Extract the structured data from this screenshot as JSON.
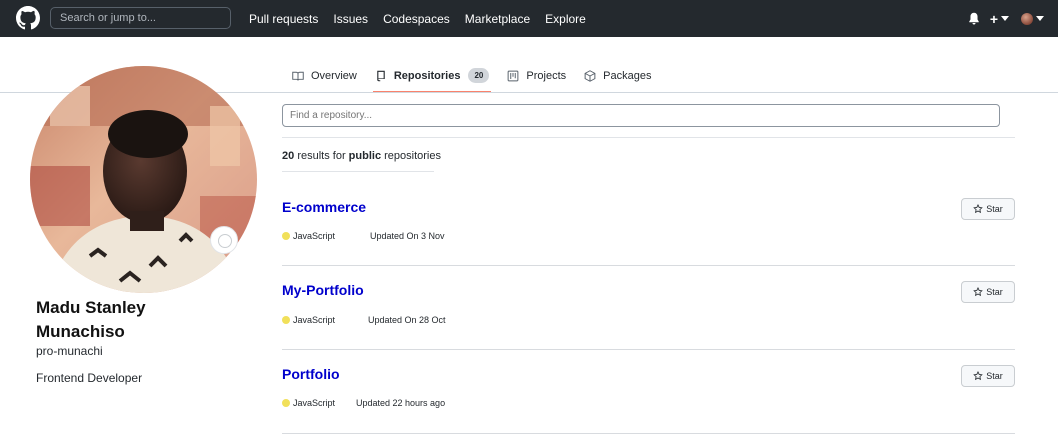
{
  "header": {
    "search_placeholder": "Search or jump to...",
    "nav": [
      "Pull requests",
      "Issues",
      "Codespaces",
      "Marketplace",
      "Explore"
    ],
    "plus_label": "+",
    "icons": [
      "github-logo-icon",
      "bell-icon",
      "plus-icon",
      "caret-down-icon"
    ]
  },
  "tabs": [
    {
      "label": "Overview",
      "icon": "book-icon"
    },
    {
      "label": "Repositories",
      "icon": "repo-icon",
      "count": "20",
      "active": true
    },
    {
      "label": "Projects",
      "icon": "project-icon"
    },
    {
      "label": "Packages",
      "icon": "package-icon"
    }
  ],
  "profile": {
    "full_name": "Madu Stanley Munachiso",
    "username": "pro-munachi",
    "bio": "Frontend Developer"
  },
  "repos_panel": {
    "find_placeholder": "Find a repository...",
    "results_count": "20",
    "results_mid": "results for",
    "results_filter": "public",
    "results_tail": "repositories"
  },
  "repos": [
    {
      "name": "E-commerce",
      "language": "JavaScript",
      "lang_color": "#f1e05a",
      "updated": "Updated On 3 Nov",
      "star_label": "Star"
    },
    {
      "name": "My-Portfolio",
      "language": "JavaScript",
      "lang_color": "#f1e05a",
      "updated": "Updated On 28 Oct",
      "star_label": "Star"
    },
    {
      "name": "Portfolio",
      "language": "JavaScript",
      "lang_color": "#f1e05a",
      "updated": "Updated 22 hours ago",
      "star_label": "Star"
    }
  ]
}
